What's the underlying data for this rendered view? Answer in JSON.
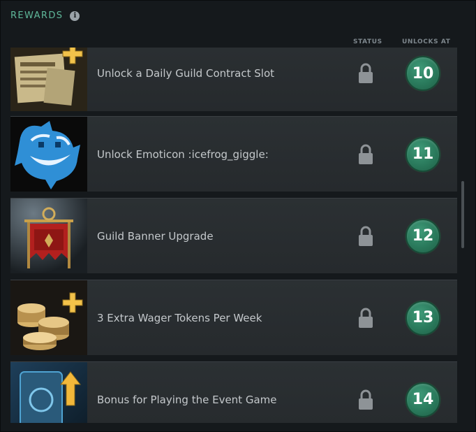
{
  "header": {
    "title": "REWARDS",
    "info_icon": "info-icon"
  },
  "columns": {
    "status": "STATUS",
    "unlocks_at": "UNLOCKS AT"
  },
  "rewards": [
    {
      "label": "Unlock a Daily Guild Contract Slot",
      "level": "10",
      "status_icon": "lock-icon",
      "image": "guild-contract-image"
    },
    {
      "label": "Unlock Emoticon :icefrog_giggle:",
      "level": "11",
      "status_icon": "lock-icon",
      "image": "icefrog-emoticon-image"
    },
    {
      "label": "Guild Banner Upgrade",
      "level": "12",
      "status_icon": "lock-icon",
      "image": "guild-banner-image"
    },
    {
      "label": "3 Extra Wager Tokens Per Week",
      "level": "13",
      "status_icon": "lock-icon",
      "image": "wager-tokens-image"
    },
    {
      "label": "Bonus for Playing the Event Game",
      "level": "14",
      "status_icon": "lock-icon",
      "image": "event-game-bonus-image"
    }
  ],
  "colors": {
    "accent": "#5fb89a",
    "badge": "#2a7a5c"
  }
}
